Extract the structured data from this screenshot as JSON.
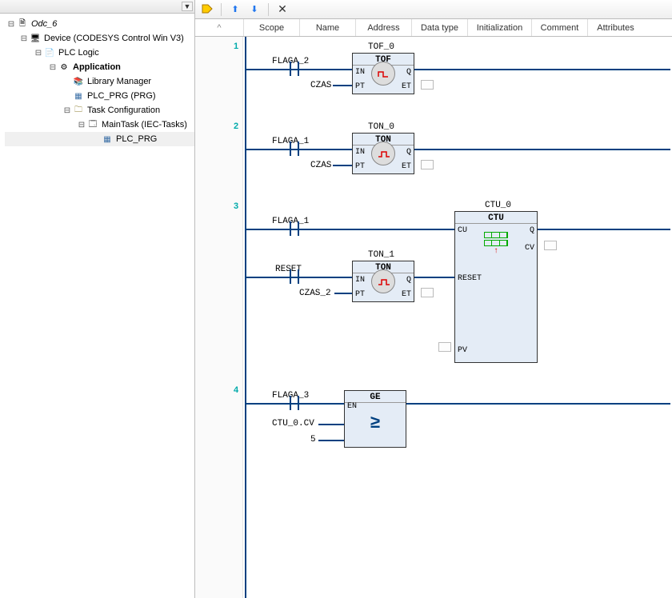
{
  "tree": {
    "root": "Odc_6",
    "device": "Device (CODESYS Control Win V3)",
    "plc_logic": "PLC Logic",
    "application": "Application",
    "library_manager": "Library Manager",
    "plc_prg": "PLC_PRG (PRG)",
    "task_config": "Task Configuration",
    "maintask": "MainTask (IEC-Tasks)",
    "plc_prg_node": "PLC_PRG"
  },
  "decl_cols": {
    "c0": "^",
    "c1": "Scope",
    "c2": "Name",
    "c3": "Address",
    "c4": "Data type",
    "c5": "Initialization",
    "c6": "Comment",
    "c7": "Attributes"
  },
  "nets": {
    "r1": "1",
    "r2": "2",
    "r3": "3",
    "r4": "4"
  },
  "labels": {
    "flaga1": "FLAGA_1",
    "flaga2": "FLAGA_2",
    "flaga3": "FLAGA_3",
    "reset": "RESET",
    "czas": "CZAS",
    "czas2": "CZAS_2",
    "ctu_cv": "CTU_0.CV",
    "five": "5"
  },
  "blocks": {
    "tof0_name": "TOF_0",
    "tof0_type": "TOF",
    "ton0_name": "TON_0",
    "ton0_type": "TON",
    "ton1_name": "TON_1",
    "ton1_type": "TON",
    "ctu0_name": "CTU_0",
    "ctu0_type": "CTU",
    "ge_type": "GE"
  },
  "pins": {
    "in": "IN",
    "pt": "PT",
    "q": "Q",
    "et": "ET",
    "cu": "CU",
    "reset": "RESET",
    "pv": "PV",
    "cv": "CV",
    "en": "EN"
  }
}
